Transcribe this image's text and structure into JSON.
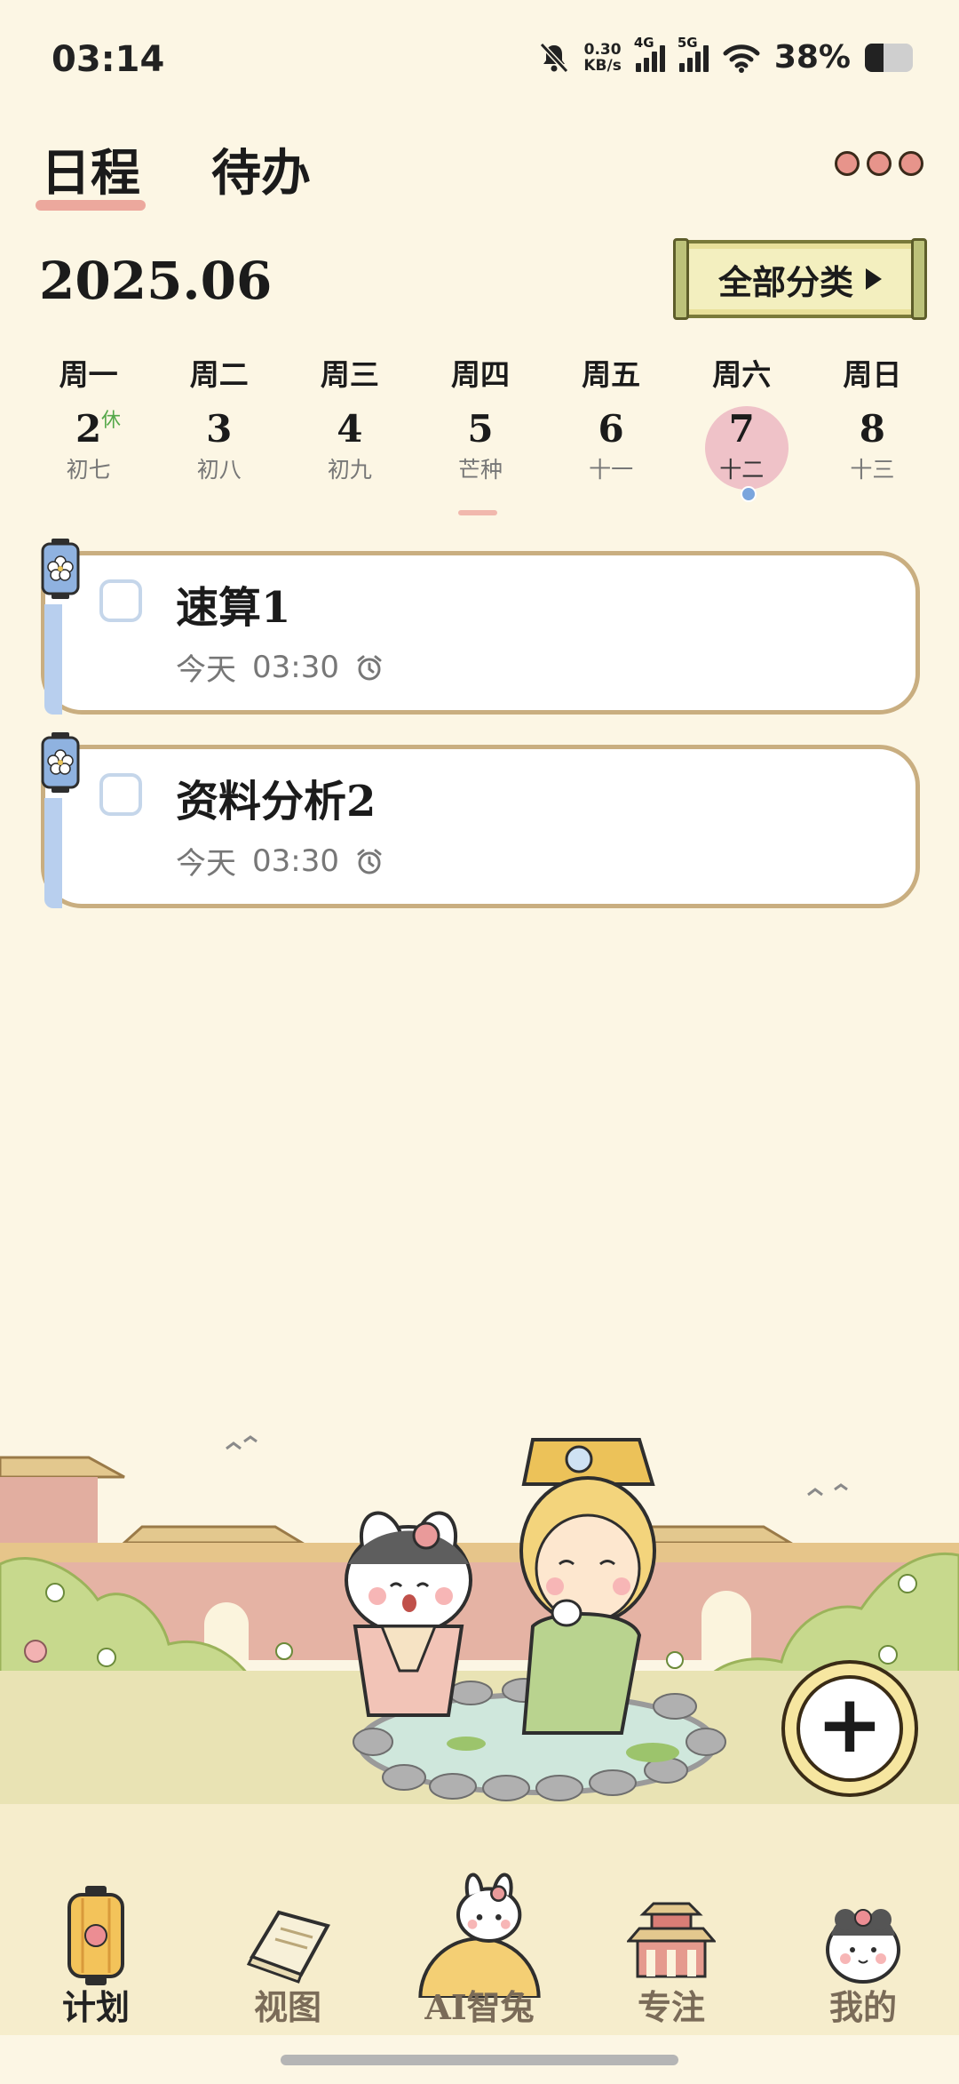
{
  "status_bar": {
    "time": "03:14",
    "net_speed_value": "0.30",
    "net_speed_unit": "KB/s",
    "sim1": "4G",
    "sim2": "5G",
    "battery_pct": "38%",
    "battery_level": 0.38
  },
  "header": {
    "tabs": [
      {
        "label": "日程",
        "active": true
      },
      {
        "label": "待办",
        "active": false
      }
    ],
    "more_icon": "more-dots-icon"
  },
  "month": "2025.06",
  "category_button": {
    "label": "全部分类"
  },
  "week": [
    {
      "weekday": "周一",
      "day": "2",
      "lunar": "初七",
      "badge": "休"
    },
    {
      "weekday": "周二",
      "day": "3",
      "lunar": "初八"
    },
    {
      "weekday": "周三",
      "day": "4",
      "lunar": "初九"
    },
    {
      "weekday": "周四",
      "day": "5",
      "lunar": "芒种"
    },
    {
      "weekday": "周五",
      "day": "6",
      "lunar": "十一"
    },
    {
      "weekday": "周六",
      "day": "7",
      "lunar": "十二",
      "selected": true
    },
    {
      "weekday": "周日",
      "day": "8",
      "lunar": "十三"
    }
  ],
  "tasks": [
    {
      "title": "速算1",
      "date": "今天",
      "time": "03:30",
      "icon": "alarm-clock-icon"
    },
    {
      "title": "资料分析2",
      "date": "今天",
      "time": "03:30",
      "icon": "alarm-clock-icon"
    }
  ],
  "fab": {
    "icon": "plus-icon"
  },
  "nav": [
    {
      "label": "计划",
      "icon": "lantern-icon",
      "active": true
    },
    {
      "label": "视图",
      "icon": "book-icon"
    },
    {
      "label": "AI智兔",
      "icon": "ai-rabbit-icon"
    },
    {
      "label": "专注",
      "icon": "palace-icon"
    },
    {
      "label": "我的",
      "icon": "rabbit-avatar-icon"
    }
  ],
  "colors": {
    "background": "#fcf6e4",
    "accent_pink": "#efc2c8",
    "card_border": "#c9ae80",
    "task_bar_blue": "#b8cfee"
  }
}
